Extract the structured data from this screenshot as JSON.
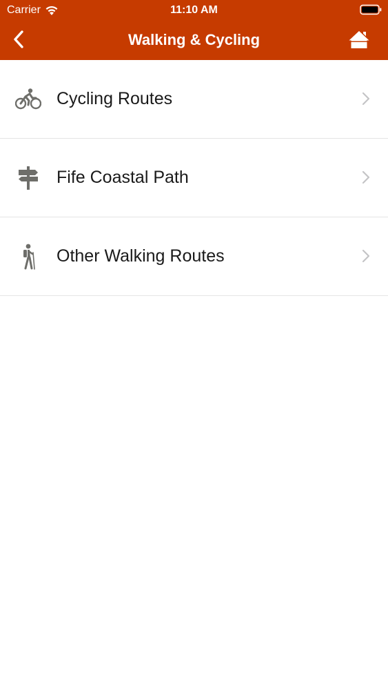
{
  "status_bar": {
    "carrier": "Carrier",
    "time": "11:10 AM"
  },
  "nav": {
    "title": "Walking & Cycling"
  },
  "colors": {
    "header": "#c63b00",
    "icon": "#6e6e6a",
    "chevron": "#c4c4c6"
  },
  "items": [
    {
      "label": "Cycling Routes",
      "icon": "cyclist-icon"
    },
    {
      "label": "Fife Coastal Path",
      "icon": "signpost-icon"
    },
    {
      "label": "Other Walking Routes",
      "icon": "hiker-icon"
    }
  ]
}
